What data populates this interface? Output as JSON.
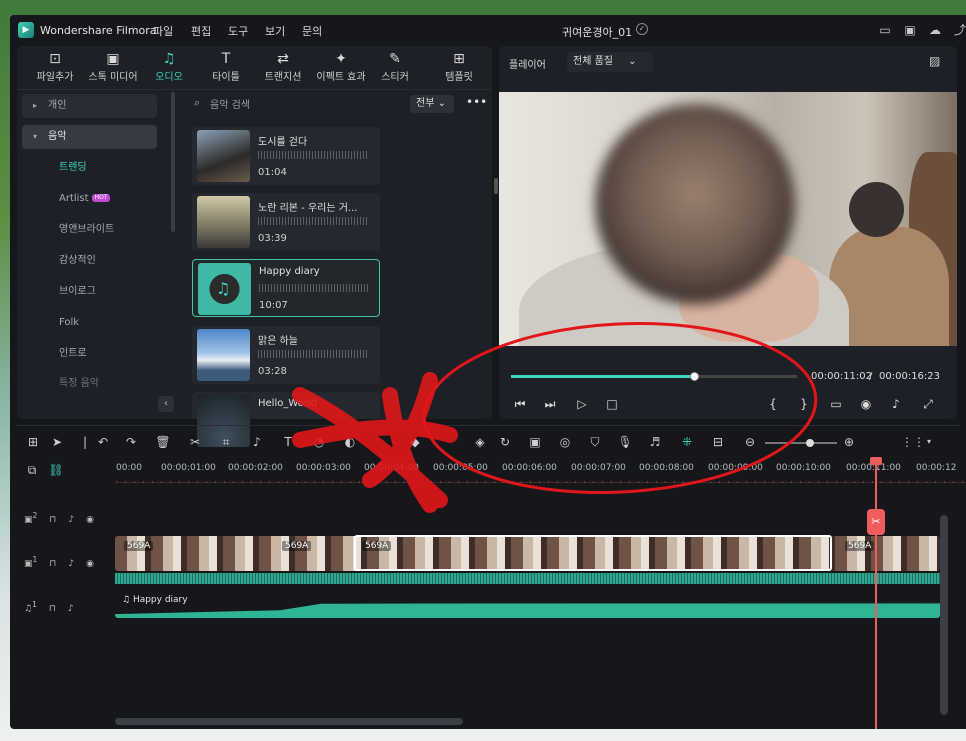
{
  "app": {
    "name": "Wondershare Filmora",
    "project": "귀여운경아_01"
  },
  "menu": [
    "파일",
    "편집",
    "도구",
    "보기",
    "문의"
  ],
  "library_tabs": [
    {
      "label": "파일추가",
      "icon": "import-icon"
    },
    {
      "label": "스톡 미디어",
      "icon": "stock-media-icon"
    },
    {
      "label": "오디오",
      "icon": "music-note-icon"
    },
    {
      "label": "타이틀",
      "icon": "text-icon"
    },
    {
      "label": "트랜지션",
      "icon": "transition-icon"
    },
    {
      "label": "이펙트 효과",
      "icon": "effects-icon"
    },
    {
      "label": "스티커",
      "icon": "sticker-icon"
    },
    {
      "label": "템플릿",
      "icon": "template-icon"
    }
  ],
  "sidebar": {
    "items": [
      {
        "label": "개인"
      },
      {
        "label": "음악"
      },
      {
        "label": "트렌딩"
      },
      {
        "label": "Artlist",
        "badge": "HOT"
      },
      {
        "label": "영앤브라이트"
      },
      {
        "label": "감상적인"
      },
      {
        "label": "브이로그"
      },
      {
        "label": "Folk"
      },
      {
        "label": "인트로"
      },
      {
        "label": "특정 음악"
      }
    ]
  },
  "search": {
    "placeholder": "음악 검색",
    "filter": "전부"
  },
  "music_list": [
    {
      "title": "도시를 걷다",
      "duration": "01:04"
    },
    {
      "title": "노란 리본 - 우리는 거...",
      "duration": "03:39"
    },
    {
      "title": "Happy diary",
      "duration": "10:07"
    },
    {
      "title": "맑은 하늘",
      "duration": "03:28"
    },
    {
      "title": "Hello_World",
      "duration": ""
    }
  ],
  "player": {
    "label": "플레이어",
    "quality": "전체 품질",
    "current_time": "00:00:11:02",
    "separator": "/",
    "total_time": "00:00:16:23",
    "progress": 0.645
  },
  "timeline": {
    "ruler": [
      "00:00",
      "00:00:01:00",
      "00:00:02:00",
      "00:00:03:00",
      "00:00:04:00",
      "00:00:05:00",
      "00:00:06:00",
      "00:00:07:00",
      "00:00:08:00",
      "00:00:09:00",
      "00:00:10:00",
      "00:00:11:00",
      "00:00:12"
    ],
    "tracks": [
      {
        "index": "2",
        "type": "video"
      },
      {
        "index": "1",
        "type": "video"
      },
      {
        "index": "1",
        "type": "audio"
      }
    ],
    "clip_labels": [
      "569A",
      "569A",
      "569A",
      "569A"
    ],
    "music_clip": "Happy diary"
  },
  "colors": {
    "accent": "#3fd6c0",
    "playhead": "#f05c5c",
    "annotation": "#e0161b"
  }
}
